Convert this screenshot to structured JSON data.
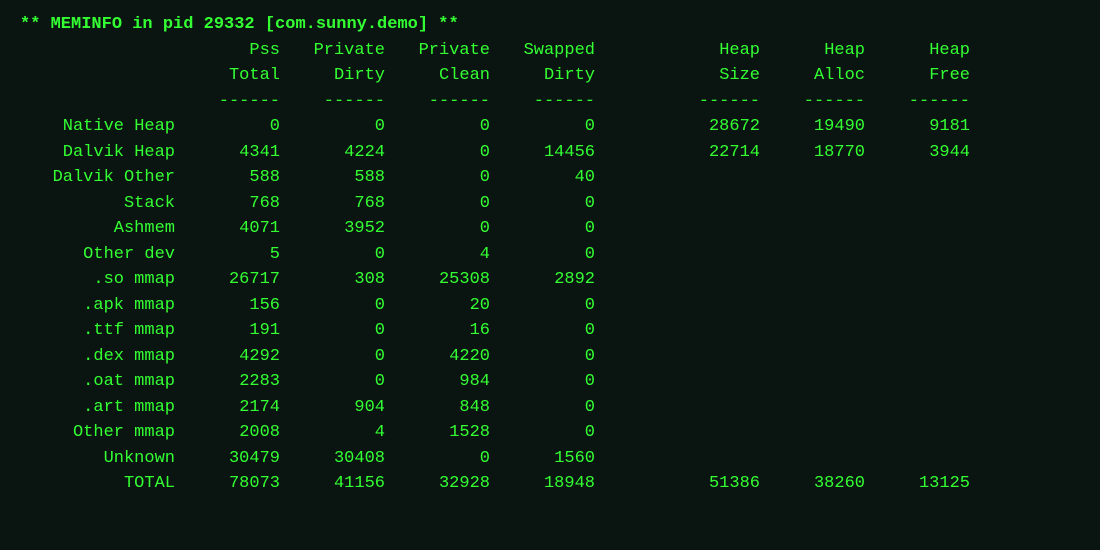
{
  "header_line": "** MEMINFO in pid 29332 [com.sunny.demo] **",
  "col_headers": {
    "pss_top": "Pss",
    "pss_bot": "Total",
    "pd_top": "Private",
    "pd_bot": "Dirty",
    "pc_top": "Private",
    "pc_bot": "Clean",
    "sd_top": "Swapped",
    "sd_bot": "Dirty",
    "hs_top": "Heap",
    "hs_bot": "Size",
    "ha_top": "Heap",
    "ha_bot": "Alloc",
    "hf_top": "Heap",
    "hf_bot": "Free",
    "sep": "------"
  },
  "rows": [
    {
      "label": "Native Heap",
      "pss": "0",
      "pd": "0",
      "pc": "0",
      "sd": "0",
      "hs": "28672",
      "ha": "19490",
      "hf": "9181"
    },
    {
      "label": "Dalvik Heap",
      "pss": "4341",
      "pd": "4224",
      "pc": "0",
      "sd": "14456",
      "hs": "22714",
      "ha": "18770",
      "hf": "3944"
    },
    {
      "label": "Dalvik Other",
      "pss": "588",
      "pd": "588",
      "pc": "0",
      "sd": "40",
      "hs": "",
      "ha": "",
      "hf": ""
    },
    {
      "label": "Stack",
      "pss": "768",
      "pd": "768",
      "pc": "0",
      "sd": "0",
      "hs": "",
      "ha": "",
      "hf": ""
    },
    {
      "label": "Ashmem",
      "pss": "4071",
      "pd": "3952",
      "pc": "0",
      "sd": "0",
      "hs": "",
      "ha": "",
      "hf": ""
    },
    {
      "label": "Other dev",
      "pss": "5",
      "pd": "0",
      "pc": "4",
      "sd": "0",
      "hs": "",
      "ha": "",
      "hf": ""
    },
    {
      "label": ".so mmap",
      "pss": "26717",
      "pd": "308",
      "pc": "25308",
      "sd": "2892",
      "hs": "",
      "ha": "",
      "hf": ""
    },
    {
      "label": ".apk mmap",
      "pss": "156",
      "pd": "0",
      "pc": "20",
      "sd": "0",
      "hs": "",
      "ha": "",
      "hf": ""
    },
    {
      "label": ".ttf mmap",
      "pss": "191",
      "pd": "0",
      "pc": "16",
      "sd": "0",
      "hs": "",
      "ha": "",
      "hf": ""
    },
    {
      "label": ".dex mmap",
      "pss": "4292",
      "pd": "0",
      "pc": "4220",
      "sd": "0",
      "hs": "",
      "ha": "",
      "hf": ""
    },
    {
      "label": ".oat mmap",
      "pss": "2283",
      "pd": "0",
      "pc": "984",
      "sd": "0",
      "hs": "",
      "ha": "",
      "hf": ""
    },
    {
      "label": ".art mmap",
      "pss": "2174",
      "pd": "904",
      "pc": "848",
      "sd": "0",
      "hs": "",
      "ha": "",
      "hf": ""
    },
    {
      "label": "Other mmap",
      "pss": "2008",
      "pd": "4",
      "pc": "1528",
      "sd": "0",
      "hs": "",
      "ha": "",
      "hf": ""
    },
    {
      "label": "Unknown",
      "pss": "30479",
      "pd": "30408",
      "pc": "0",
      "sd": "1560",
      "hs": "",
      "ha": "",
      "hf": ""
    },
    {
      "label": "TOTAL",
      "pss": "78073",
      "pd": "41156",
      "pc": "32928",
      "sd": "18948",
      "hs": "51386",
      "ha": "38260",
      "hf": "13125"
    }
  ]
}
